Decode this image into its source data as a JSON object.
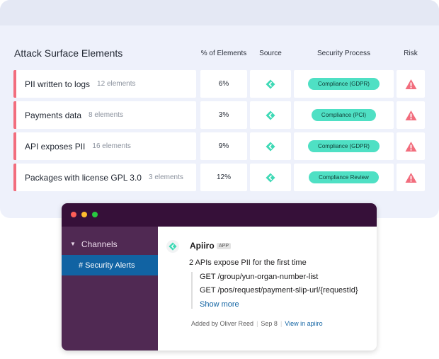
{
  "panel": {
    "title": "Attack Surface Elements",
    "headers": {
      "percent": "% of Elements",
      "source": "Source",
      "process": "Security Process",
      "risk": "Risk"
    },
    "rows": [
      {
        "name": "PII written to logs",
        "count": "12 elements",
        "percent": "6%",
        "process": "Compliance (GDPR)"
      },
      {
        "name": "Payments data",
        "count": "8 elements",
        "percent": "3%",
        "process": "Compliance (PCI)"
      },
      {
        "name": "API exposes PII",
        "count": "16 elements",
        "percent": "9%",
        "process": "Compliance (GDPR)"
      },
      {
        "name": "Packages with license GPL 3.0",
        "count": "3 elements",
        "percent": "12%",
        "process": "Compliance Review"
      }
    ],
    "icons": {
      "source": "apiiro-diamond-icon",
      "risk": "warning-icon"
    },
    "colors": {
      "accent": "#f26d7d",
      "pill": "#4fe0c4",
      "source": "#3dd9b5",
      "warning": "#f26d7d"
    }
  },
  "slack": {
    "sidebar": {
      "section": "Channels",
      "channel": "# Security Alerts"
    },
    "message": {
      "sender": "Apiiro",
      "badge": "APP",
      "text": "2 APIs expose PII for the first time",
      "lines": [
        "GET /group/yun-organ-number-list",
        "GET /pos/request/payment-slip-url/{requestId}"
      ],
      "show_more": "Show more",
      "footer": {
        "added_by": "Added by Oliver Reed",
        "date": "Sep 8",
        "link": "View in apiiro"
      }
    },
    "colors": {
      "titlebar": "#361039",
      "sidebar": "#502953",
      "selected": "#1163a3",
      "link": "#1264a3"
    }
  }
}
